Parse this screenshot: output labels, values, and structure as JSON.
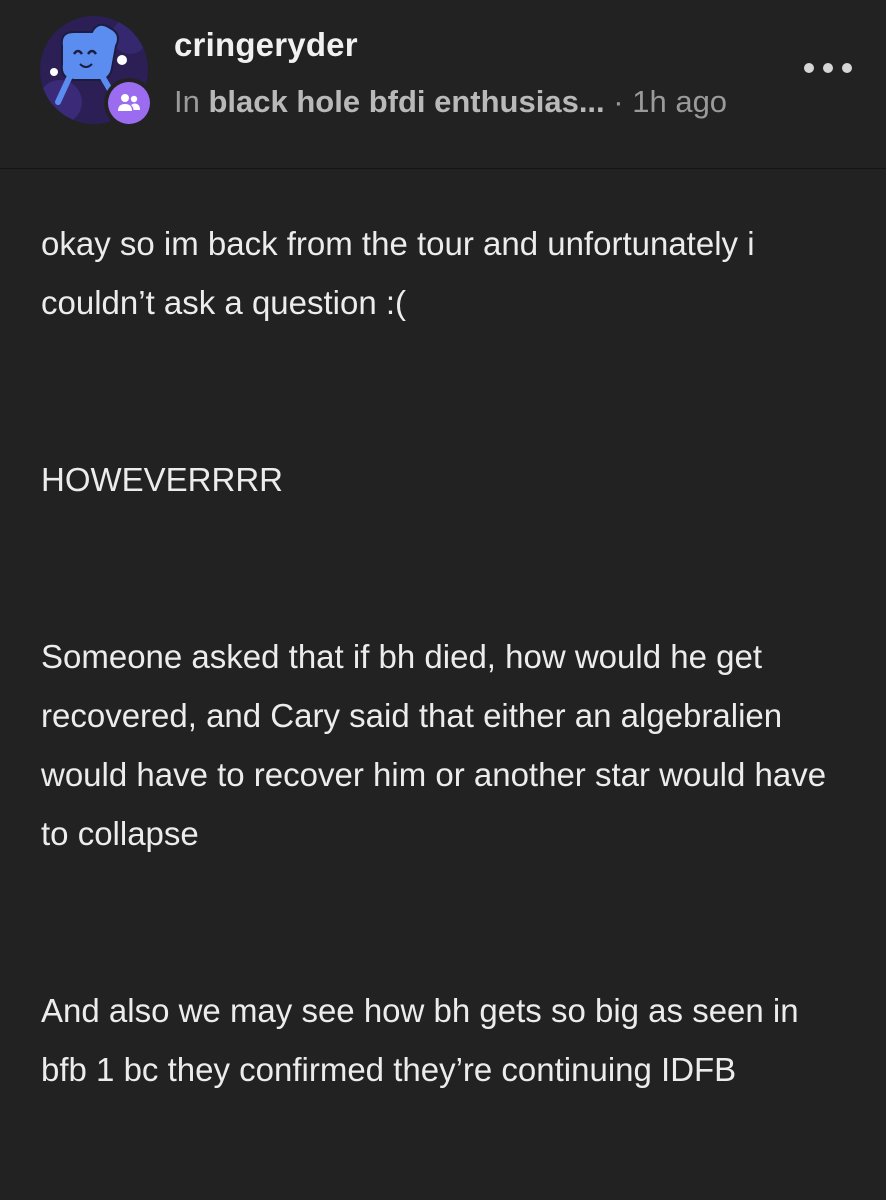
{
  "post": {
    "username": "cringeryder",
    "meta_prefix": "In ",
    "community": "black hole bfdi enthusias...",
    "meta_separator": " · ",
    "time": "1h ago",
    "avatar_icon": "cartoon-character-avatar",
    "community_icon": "group-people-icon",
    "more_icon": "more-dots-icon",
    "paragraphs": [
      "okay so im back from the tour and unfortunately i couldn’t ask a question :(",
      "HOWEVERRRR",
      "Someone asked that if bh died, how would he get recovered, and Cary said that either an algebralien would have to recover him or another star would have to collapse",
      "And also we may see how bh gets so big as seen in bfb 1 bc they confirmed they’re continuing IDFB"
    ]
  },
  "colors": {
    "background": "#222223",
    "text": "#ececec",
    "muted": "#9a9a9a",
    "community_badge": "#9b6cf0"
  }
}
